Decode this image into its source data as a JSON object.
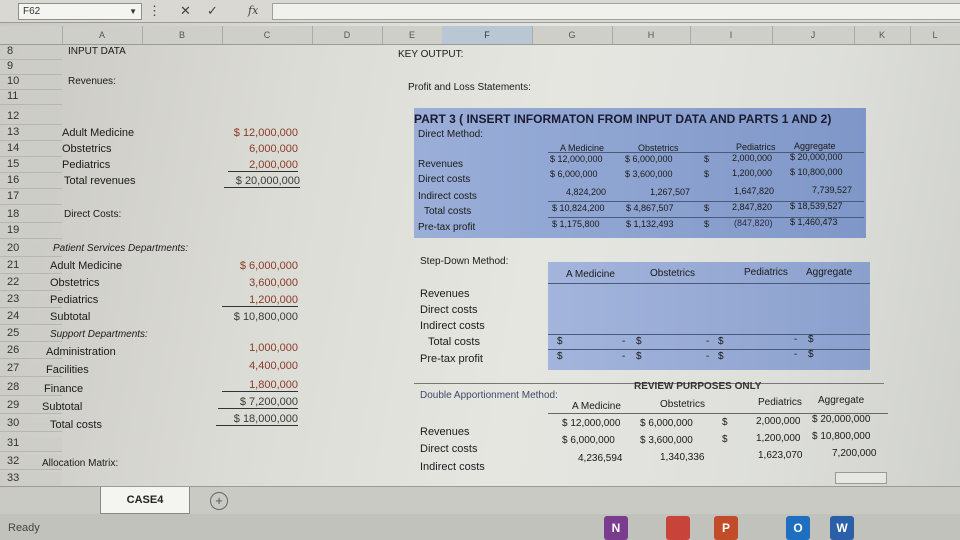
{
  "formula_bar": {
    "cell_ref": "F62",
    "fx": "fx"
  },
  "columns": [
    "A",
    "B",
    "C",
    "D",
    "E",
    "F",
    "G",
    "H",
    "I",
    "J",
    "K",
    "L"
  ],
  "rows": [
    "8",
    "9",
    "10",
    "11",
    "12",
    "13",
    "14",
    "15",
    "16",
    "17",
    "18",
    "19",
    "20",
    "21",
    "22",
    "23",
    "24",
    "25",
    "26",
    "27",
    "28",
    "29",
    "30",
    "31",
    "32",
    "33"
  ],
  "left": {
    "input_data": "INPUT DATA",
    "revenues": "Revenues:",
    "rev_items": [
      {
        "label": "Adult Medicine",
        "value": "$ 12,000,000"
      },
      {
        "label": "Obstetrics",
        "value": "6,000,000"
      },
      {
        "label": "Pediatrics",
        "value": "2,000,000"
      },
      {
        "label": "Total revenues",
        "value": "$ 20,000,000"
      }
    ],
    "direct_costs": "Direct Costs:",
    "psd": "Patient Services Departments:",
    "psd_items": [
      {
        "label": "Adult Medicine",
        "value": "$ 6,000,000"
      },
      {
        "label": "Obstetrics",
        "value": "3,600,000"
      },
      {
        "label": "Pediatrics",
        "value": "1,200,000"
      },
      {
        "label": "Subtotal",
        "value": "$ 10,800,000"
      }
    ],
    "support": "Support Departments:",
    "support_items": [
      {
        "label": "Administration",
        "value": "1,000,000"
      },
      {
        "label": "Facilities",
        "value": "4,400,000"
      },
      {
        "label": "Finance",
        "value": "1,800,000"
      },
      {
        "label": "Subtotal",
        "value": "$ 7,200,000"
      }
    ],
    "total_costs": "Total costs",
    "total_costs_value": "$ 18,000,000",
    "alloc": "Allocation Matrix:"
  },
  "right": {
    "key_output": "KEY OUTPUT:",
    "pl": "Profit and Loss Statements:",
    "part3": "PART 3  ( INSERT INFORMATON FROM INPUT DATA AND PARTS 1 AND 2)",
    "direct_method": "Direct Method:",
    "dm_headers": [
      "A Medicine",
      "Obstetrics",
      "Pediatrics",
      "Aggregate"
    ],
    "dm_rows": [
      {
        "label": "Revenues",
        "vals": [
          "$ 12,000,000",
          "$ 6,000,000",
          "$",
          "2,000,000",
          "$ 20,000,000"
        ]
      },
      {
        "label": "Direct costs",
        "vals": [
          "$ 6,000,000",
          "$ 3,600,000",
          "$",
          "1,200,000",
          "$ 10,800,000"
        ]
      },
      {
        "label": "Indirect costs",
        "vals": [
          "4,824,200",
          "1,267,507",
          "",
          "1,647,820",
          "7,739,527"
        ]
      },
      {
        "label": "Total costs",
        "vals": [
          "$ 10,824,200",
          "$ 4,867,507",
          "$",
          "2,847,820",
          "$ 18,539,527"
        ]
      },
      {
        "label": "Pre-tax profit",
        "vals": [
          "$ 1,175,800",
          "$ 1,132,493",
          "$",
          "(847,820)",
          "$ 1,460,473"
        ]
      }
    ],
    "step_down": "Step-Down Method:",
    "sd_headers": [
      "A Medicine",
      "Obstetrics",
      "Pediatrics",
      "Aggregate"
    ],
    "sd_labels": [
      "Revenues",
      "Direct costs",
      "Indirect costs",
      "Total costs",
      "Pre-tax profit"
    ],
    "sd_dollar": "$",
    "sd_dash": "-",
    "double": "Double Apportionment Method:",
    "review": "REVIEW PURPOSES ONLY",
    "da_headers": [
      "A Medicine",
      "Obstetrics",
      "Pediatrics",
      "Aggregate"
    ],
    "da_rows": [
      {
        "label": "Revenues",
        "vals": [
          "$ 12,000,000",
          "$ 6,000,000",
          "$",
          "2,000,000",
          "$ 20,000,000"
        ]
      },
      {
        "label": "Direct costs",
        "vals": [
          "$ 6,000,000",
          "$ 3,600,000",
          "$",
          "1,200,000",
          "$ 10,800,000"
        ]
      },
      {
        "label": "Indirect costs",
        "vals": [
          "4,236,594",
          "1,340,336",
          "",
          "1,623,070",
          "7,200,000"
        ]
      }
    ]
  },
  "sheet_tab": "CASE4",
  "add_sheet": "+",
  "status": "Ready",
  "taskbar": [
    "N",
    "",
    "P",
    "O",
    "W"
  ]
}
